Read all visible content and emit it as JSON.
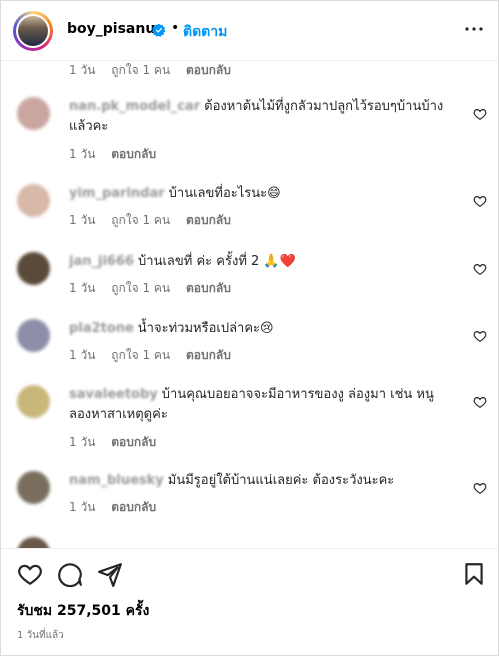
{
  "header": {
    "username": "boy_pisanu",
    "separator": "•",
    "follow_label": "ติดตาม"
  },
  "comments": [
    {
      "user": "",
      "text": "",
      "time": "1 วัน",
      "likes": "ถูกใจ 1 คน",
      "reply": "ตอบกลับ",
      "avatar_color": "#c8a58a"
    },
    {
      "user": "nan.pk_model_car",
      "text": "ต้องหาต้นไม้ที่งูกลัวมาปลูกไว้รอบๆบ้านบ้าง แล้วคะ",
      "time": "1 วัน",
      "likes": "",
      "reply": "ตอบกลับ",
      "avatar_color": "#c9a7a0"
    },
    {
      "user": "yim_parindar",
      "text": "บ้านเลขที่อะไรนะ😄",
      "time": "1 วัน",
      "likes": "ถูกใจ 1 คน",
      "reply": "ตอบกลับ",
      "avatar_color": "#d8b8a8"
    },
    {
      "user": "jan_ji666",
      "text": "บ้านเลขที่ ค่ะ ครั้งที่ 2 🙏❤️",
      "time": "1 วัน",
      "likes": "ถูกใจ 1 คน",
      "reply": "ตอบกลับ",
      "avatar_color": "#5a4a3a"
    },
    {
      "user": "pla2tone",
      "text": "น้ำจะท่วมหรือเปล่าคะ😢",
      "time": "1 วัน",
      "likes": "ถูกใจ 1 คน",
      "reply": "ตอบกลับ",
      "avatar_color": "#8d8ea8"
    },
    {
      "user": "savaleetoby",
      "text": "บ้านคุณบอยอาจจะมีอาหารของงู ล่องูมา เช่น หนู ลองหาสาเหตุดูค่ะ",
      "time": "1 วัน",
      "likes": "",
      "reply": "ตอบกลับ",
      "avatar_color": "#c9b77a"
    },
    {
      "user": "nam_bluesky",
      "text": "มันมีรูอยู่ใต้บ้านแน่เลยค่ะ ต้องระวังนะคะ",
      "time": "1 วัน",
      "likes": "",
      "reply": "ตอบกลับ",
      "avatar_color": "#7a6f5e"
    }
  ],
  "footer": {
    "views": "รับชม 257,501 ครั้ง",
    "ago": "1 วันที่แล้ว"
  },
  "icons": {
    "verified": "verified-badge-icon",
    "more": "more-options-icon",
    "like": "heart-outline-icon",
    "comment": "comment-bubble-icon",
    "share": "paper-plane-icon",
    "save": "bookmark-icon"
  },
  "colors": {
    "accent": "#0095f6",
    "meta": "#737373"
  }
}
